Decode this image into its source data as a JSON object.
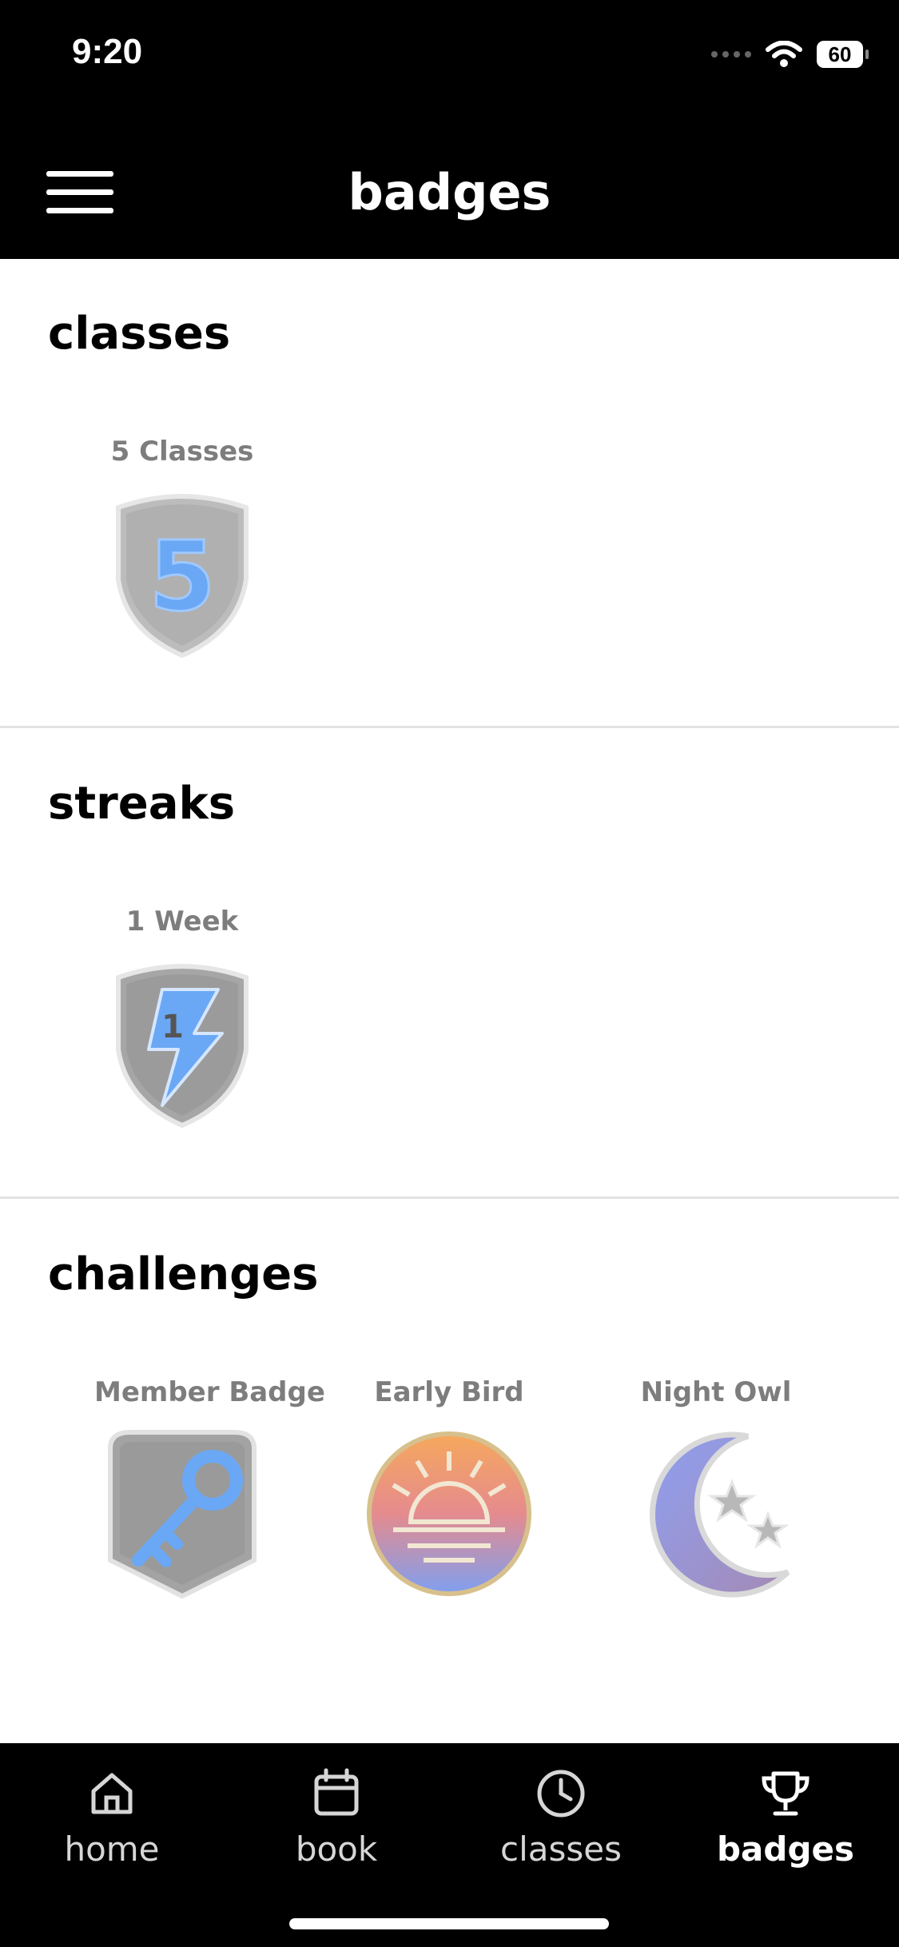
{
  "status_bar": {
    "time": "9:20",
    "battery": "60"
  },
  "header": {
    "title": "badges"
  },
  "sections": {
    "classes": {
      "title": "classes",
      "badges": [
        {
          "label": "5 Classes",
          "icon": "five-classes-shield-icon"
        }
      ]
    },
    "streaks": {
      "title": "streaks",
      "badges": [
        {
          "label": "1 Week",
          "icon": "one-week-lightning-shield-icon"
        }
      ]
    },
    "challenges": {
      "title": "challenges",
      "badges": [
        {
          "label": "Member Badge",
          "icon": "key-badge-icon"
        },
        {
          "label": "Early Bird",
          "icon": "sunrise-badge-icon"
        },
        {
          "label": "Night Owl",
          "icon": "moon-stars-badge-icon"
        }
      ]
    }
  },
  "tab_bar": {
    "tabs": [
      {
        "label": "home",
        "icon": "home-icon"
      },
      {
        "label": "book",
        "icon": "calendar-icon"
      },
      {
        "label": "classes",
        "icon": "clock-icon"
      },
      {
        "label": "badges",
        "icon": "trophy-icon",
        "active": true
      }
    ]
  },
  "colors": {
    "accent_blue": "#6aa8f5",
    "badge_gray": "#a9a9a9",
    "label_gray": "#7d7d7d"
  }
}
